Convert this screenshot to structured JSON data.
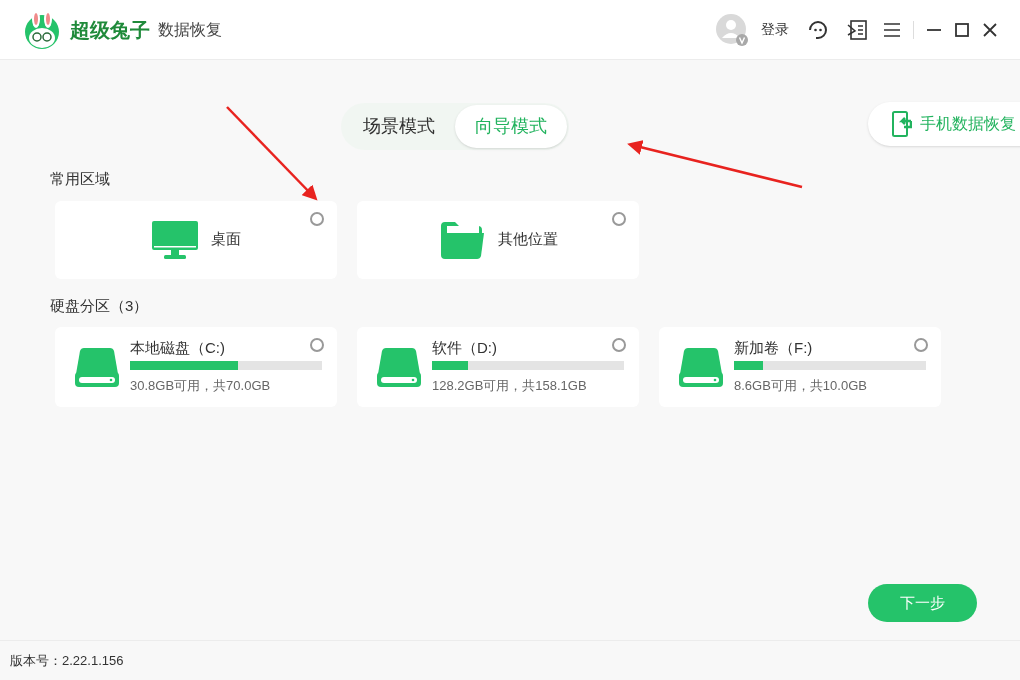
{
  "app": {
    "brand": "超级兔子",
    "product": "数据恢复"
  },
  "header": {
    "login": "登录"
  },
  "modes": [
    {
      "label": "场景模式",
      "selected": false
    },
    {
      "label": "向导模式",
      "selected": true
    }
  ],
  "phone_recovery": "手机数据恢复",
  "common_area": {
    "title": "常用区域",
    "items": [
      {
        "kind": "desktop",
        "label": "桌面",
        "selected": false
      },
      {
        "kind": "folder",
        "label": "其他位置",
        "selected": false
      }
    ]
  },
  "disks": {
    "title": "硬盘分区（3）",
    "items": [
      {
        "name": "本地磁盘（C:)",
        "level": 0.56,
        "usage": "30.8GB可用，共70.0GB",
        "selected": false
      },
      {
        "name": "软件（D:)",
        "level": 0.19,
        "usage": "128.2GB可用，共158.1GB",
        "selected": false
      },
      {
        "name": "新加卷（F:)",
        "level": 0.15,
        "usage": "8.6GB可用，共10.0GB",
        "selected": false
      }
    ]
  },
  "next_button": "下一步",
  "footer": {
    "version": "版本号：2.22.1.156"
  }
}
